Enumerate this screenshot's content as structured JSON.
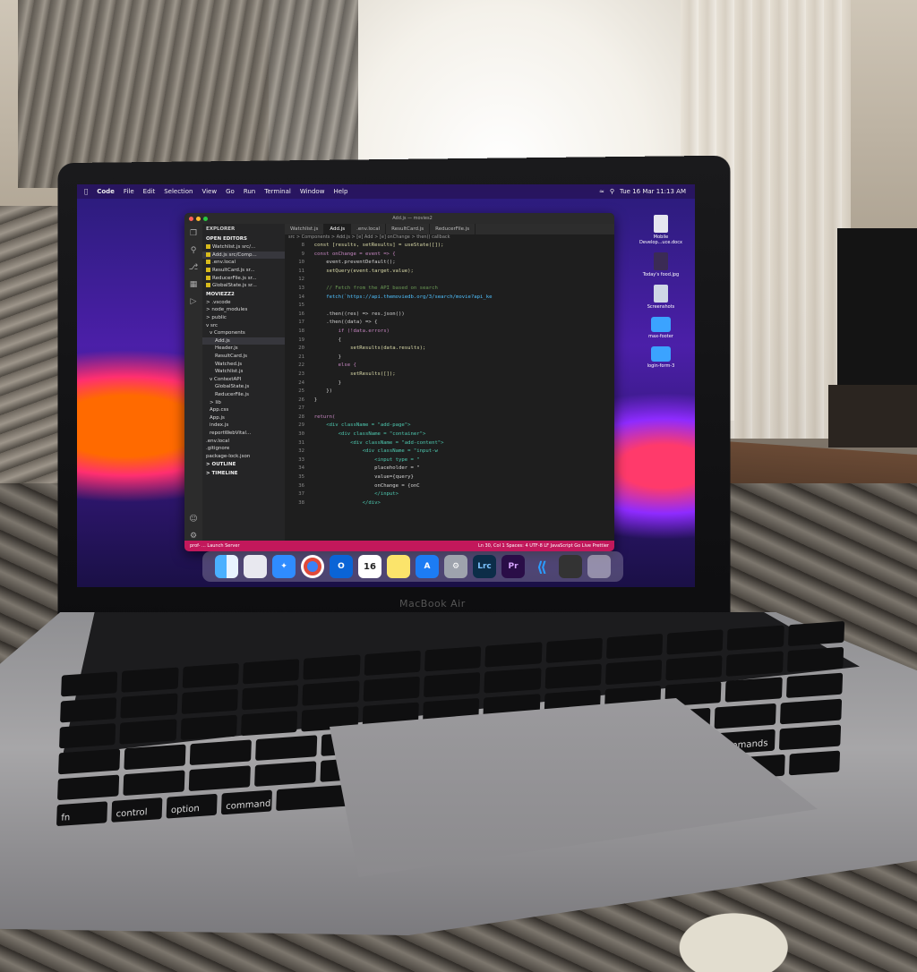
{
  "menubar": {
    "app": "Code",
    "items": [
      "File",
      "Edit",
      "Selection",
      "View",
      "Go",
      "Run",
      "Terminal",
      "Window",
      "Help"
    ],
    "clock": "Tue 16 Mar  11:13 AM"
  },
  "vscode": {
    "window_title": "Add.js — movies2",
    "explorer_header": "EXPLORER",
    "open_editors_label": "OPEN EDITORS",
    "open_editors": [
      "Watchlist.js src/...",
      "Add.js src/Comp...",
      ".env.local",
      "ResultCard.js sr...",
      "ReducerFile.js sr...",
      "GlobalState.js sr..."
    ],
    "project_label": "MOVIEZZ2",
    "tree": [
      "> .vscode",
      "> node_modules",
      "> public",
      "v src",
      "v Components",
      "Add.js",
      "Header.js",
      "ResultCard.js",
      "Watched.js",
      "Watchlist.js",
      "v ContextAPI",
      "GlobalState.js",
      "ReducerFile.js",
      "> lib",
      "App.css",
      "App.js",
      "index.js",
      "reportWebVital...",
      ".env.local",
      ".gitignore",
      "package-lock.json"
    ],
    "outline_label": "> OUTLINE",
    "timeline_label": "> TIMELINE",
    "tabs": [
      "Watchlist.js",
      "Add.js",
      ".env.local",
      "ResultCard.js",
      "ReducerFile.js"
    ],
    "breadcrumb": "src > Components > Add.js > [e] Add > [e] onChange > then() callback",
    "line_numbers": [
      "8",
      "9",
      "10",
      "11",
      "12",
      "13",
      "14",
      "15",
      "16",
      "17",
      "18",
      "19",
      "20",
      "21",
      "22",
      "23",
      "24",
      "25",
      "26",
      "27",
      "28",
      "29",
      "30",
      "31",
      "32",
      "33",
      "34",
      "35",
      "36",
      "37",
      "38"
    ],
    "code_lines": [
      "  const [results, setResults] = useState([]);",
      "  const onChange = event => {",
      "      event.preventDefault();",
      "      setQuery(event.target.value);",
      "",
      "      // Fetch from the API based on search",
      "      fetch(`https://api.themoviedb.org/3/search/movie?api_ke",
      "",
      "      .then((res) => res.json())",
      "      .then((data) => {",
      "          if (!data.errors)",
      "          {",
      "              setResults(data.results);",
      "          }",
      "          else {",
      "              setResults([]);",
      "          }",
      "      })",
      "  }",
      "",
      "  return(",
      "      <div className = \"add-page\">",
      "          <div className = \"container\">",
      "              <div className = \"add-content\">",
      "                  <div className = \"input-w",
      "                      <input type = \"",
      "                      placeholder = \"",
      "                      value={query}",
      "                      onChange = {onC",
      "                      </input>",
      "                  </div>"
    ],
    "status_left": "prof- ... Launch Server",
    "status_right": "Ln 30, Col 1   Spaces: 4   UTF-8   LF   JavaScript   Go Live   Prettier"
  },
  "desktop_icons": [
    "Mobile Develop...uce.docx",
    "Today's food.jpg",
    "Screenshots",
    "max-footer",
    "login-form-3"
  ],
  "dock": {
    "calendar_day": "16",
    "icons": [
      "finder-icon",
      "launchpad-icon",
      "safari-icon",
      "chrome-icon",
      "outlook-icon",
      "calendar-icon",
      "notes-icon",
      "app-store-icon",
      "settings-icon",
      "lightroom-icon",
      "premiere-icon",
      "vscode-icon",
      "screen-icon",
      "trash-icon"
    ],
    "lrc_label": "Lrc",
    "pr_label": "Pr"
  },
  "laptop_label": "MacBook Air",
  "keyboard": {
    "rows": [
      [
        "",
        "",
        "",
        "",
        "",
        "",
        "",
        "",
        "",
        "",
        "",
        "",
        ""
      ],
      [
        "",
        "",
        "",
        "",
        "",
        "",
        "",
        "",
        "",
        "",
        "",
        "",
        ""
      ],
      [
        "",
        "",
        "",
        "",
        "",
        "",
        "",
        "",
        "",
        "",
        "",
        "",
        ""
      ],
      [
        "",
        "",
        "",
        "",
        "",
        "",
        "",
        "",
        "",
        "",
        "",
        ""
      ],
      [
        "",
        "",
        "",
        "",
        "",
        "",
        "",
        "",
        "",
        "",
        "commands",
        ""
      ],
      [
        "fn",
        "control",
        "option",
        "command",
        "",
        "",
        "",
        "",
        "",
        "",
        ""
      ]
    ]
  },
  "colors": {
    "editor_bg": "#1e1e1e",
    "status_bar": "#c2185b",
    "wallpaper_accent": "#ff2f70"
  }
}
